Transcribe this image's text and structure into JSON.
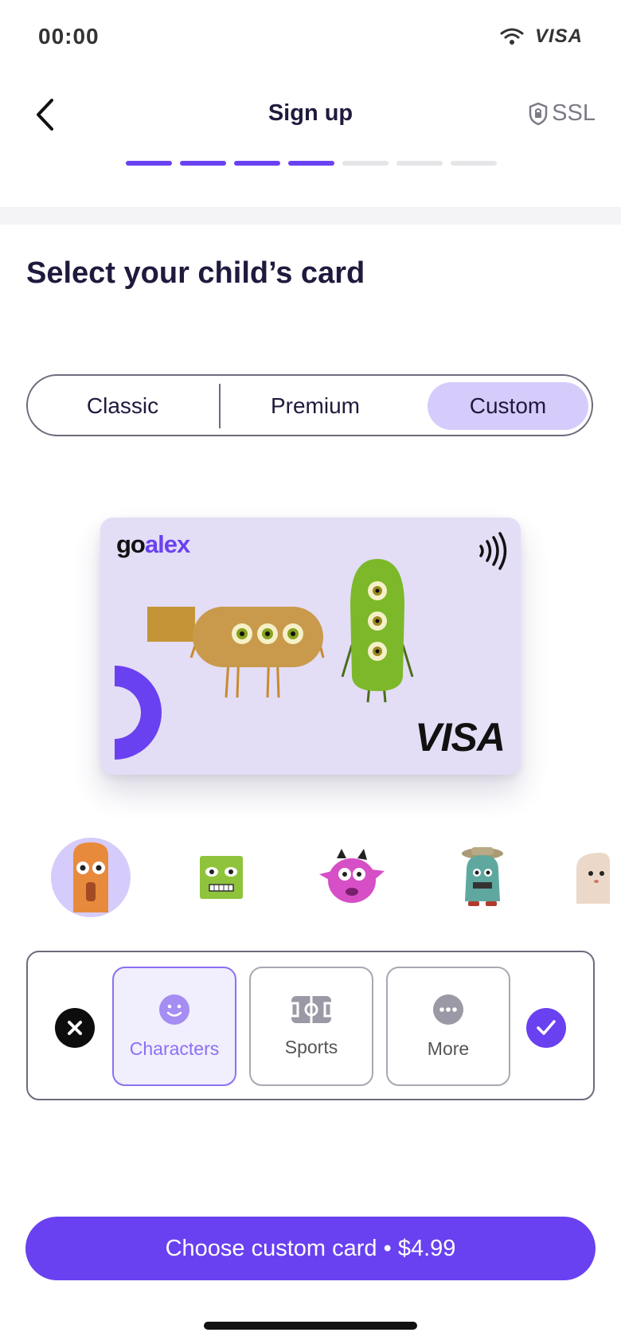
{
  "status_bar": {
    "time": "00:00",
    "carrier": "VISA"
  },
  "header": {
    "title": "Sign up",
    "security_label": "SSL",
    "progress": {
      "completed_steps": 4,
      "total_steps": 7
    }
  },
  "heading": "Select your child’s card",
  "card_types": {
    "options": [
      "Classic",
      "Premium",
      "Custom"
    ],
    "selected": "Custom"
  },
  "card": {
    "logo_prefix": "go",
    "logo_suffix": "alex",
    "brand": "VISA"
  },
  "characters": {
    "items": [
      "orange-monster-icon",
      "green-monster-icon",
      "pink-monster-icon",
      "teal-monster-icon",
      "beige-monster-icon"
    ],
    "selected_index": 0
  },
  "categories": {
    "items": [
      {
        "label": "Characters",
        "icon": "smiley-icon"
      },
      {
        "label": "Sports",
        "icon": "field-icon"
      },
      {
        "label": "More",
        "icon": "more-icon"
      }
    ],
    "selected": "Characters"
  },
  "cta": {
    "label": "Choose custom card • $4.99"
  },
  "colors": {
    "accent": "#6a41f0",
    "accent_light": "#d6ccfb",
    "card_bg": "#e3ddf6",
    "text": "#1f1a3d"
  }
}
